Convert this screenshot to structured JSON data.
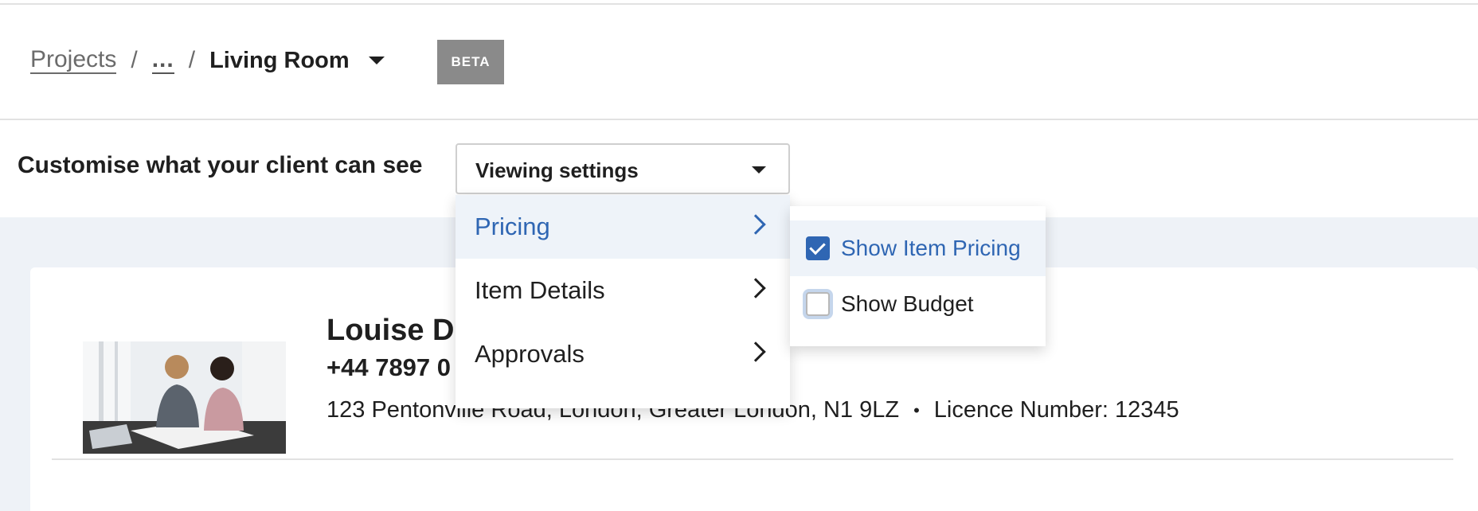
{
  "breadcrumb": {
    "projects_label": "Projects",
    "separator": "/",
    "ellipsis_label": "...",
    "current_label": "Living Room",
    "badge_label": "BETA"
  },
  "customise": {
    "label": "Customise what your client can see",
    "select_label": "Viewing settings"
  },
  "menu": {
    "items": [
      {
        "label": "Pricing",
        "active": true
      },
      {
        "label": "Item Details",
        "active": false
      },
      {
        "label": "Approvals",
        "active": false
      }
    ]
  },
  "submenu": {
    "items": [
      {
        "label": "Show Item Pricing",
        "checked": true
      },
      {
        "label": "Show Budget",
        "checked": false
      }
    ]
  },
  "company": {
    "name": "Louise De",
    "phone": "+44 7897 0",
    "address": "123 Pentonville Road, London, Greater London, N1 9LZ",
    "dot": "•",
    "licence": "Licence Number: 12345"
  },
  "colors": {
    "accent": "#2f66b3",
    "active_bg": "#eef3f9",
    "page_bg": "#eef2f7",
    "beta_bg": "#8a8a8a"
  },
  "icons": {
    "dropdown": "caret-down-icon",
    "menu_chevron": "chevron-right-icon",
    "checkbox_on": "checkbox-checked-icon",
    "checkbox_off": "checkbox-empty-icon"
  }
}
